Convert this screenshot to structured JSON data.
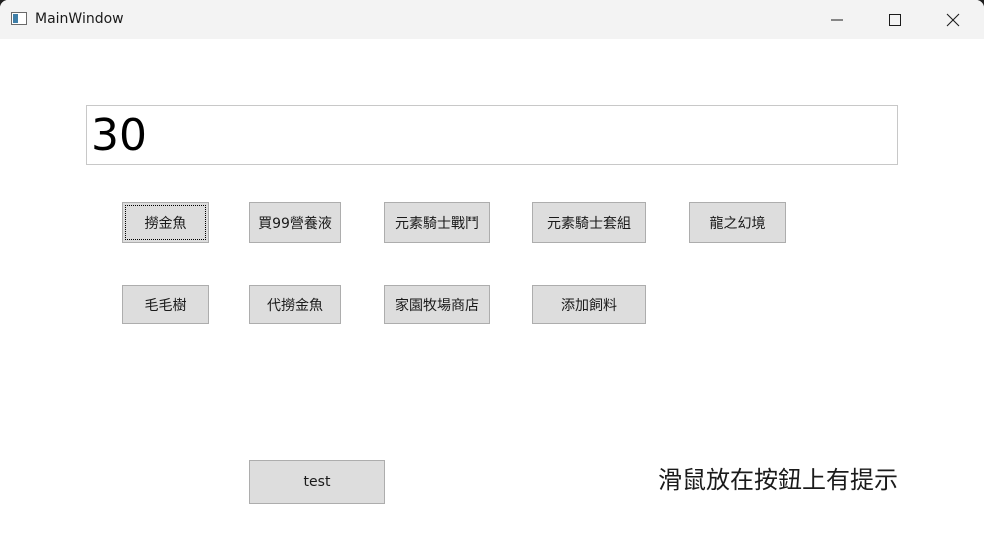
{
  "window": {
    "title": "MainWindow",
    "icon": "app-window-icon",
    "controls": {
      "minimize_icon": "minimize-icon",
      "maximize_icon": "maximize-icon",
      "close_icon": "close-icon"
    }
  },
  "display": {
    "value": "30"
  },
  "buttons": {
    "row1": [
      "撈金魚",
      "買99營養液",
      "元素騎士戰鬥",
      "元素騎士套組",
      "龍之幻境"
    ],
    "row2": [
      "毛毛樹",
      "代撈金魚",
      "家園牧場商店",
      "添加飼料"
    ],
    "test": "test"
  },
  "hint": "滑鼠放在按鈕上有提示",
  "colors": {
    "button_bg": "#dddddd",
    "button_border": "#adadad",
    "titlebar_bg": "#f3f3f3"
  }
}
